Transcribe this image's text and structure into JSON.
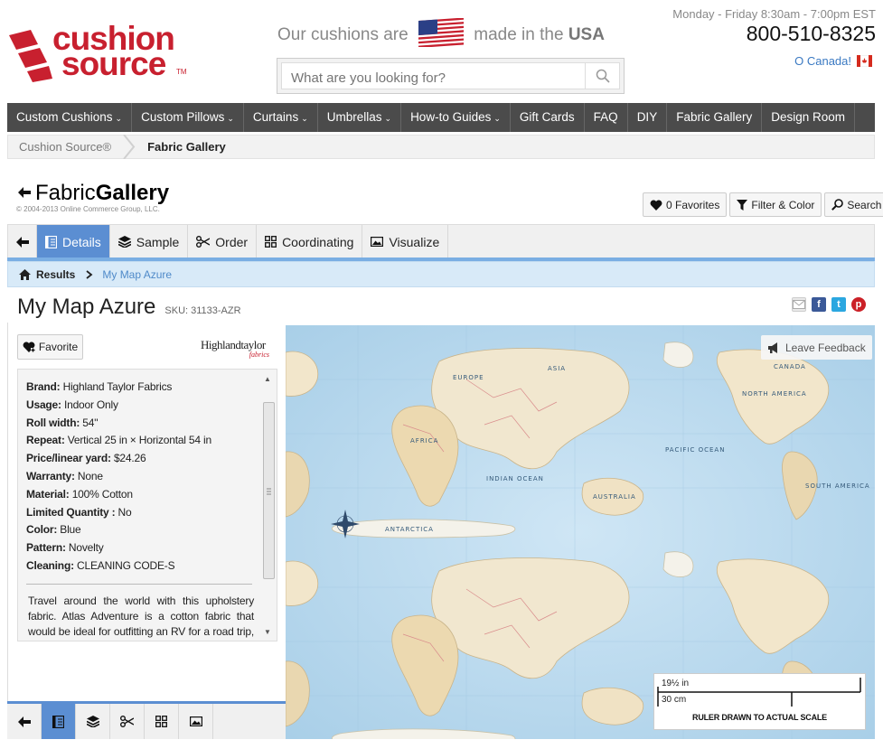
{
  "header": {
    "logo_line1": "cushion",
    "logo_line2": "source",
    "logo_tm": "TM",
    "tagline_pre": "Our cushions are",
    "tagline_mid": "made in the",
    "tagline_bold": "USA",
    "search_placeholder": "What are you looking for?",
    "hours": "Monday - Friday 8:30am - 7:00pm EST",
    "phone": "800-510-8325",
    "canada": "O Canada!"
  },
  "nav": [
    {
      "label": "Custom Cushions",
      "dropdown": true
    },
    {
      "label": "Custom Pillows",
      "dropdown": true
    },
    {
      "label": "Curtains",
      "dropdown": true
    },
    {
      "label": "Umbrellas",
      "dropdown": true
    },
    {
      "label": "How-to Guides",
      "dropdown": true
    },
    {
      "label": "Gift Cards",
      "dropdown": false
    },
    {
      "label": "FAQ",
      "dropdown": false
    },
    {
      "label": "DIY",
      "dropdown": false
    },
    {
      "label": "Fabric Gallery",
      "dropdown": false
    },
    {
      "label": "Design Room",
      "dropdown": false
    }
  ],
  "breadcrumb": {
    "home": "Cushion Source®",
    "current": "Fabric Gallery"
  },
  "gallery": {
    "title_light": "Fabric",
    "title_bold": "Gallery",
    "copyright": "© 2004-2013 Online Commerce Group, LLC.",
    "favorites_label": "0 Favorites",
    "filter_label": "Filter & Color",
    "search_label": "Search"
  },
  "tabs": [
    {
      "label": "",
      "icon": "back-arrow-icon",
      "active": false
    },
    {
      "label": "Details",
      "icon": "book-icon",
      "active": true
    },
    {
      "label": "Sample",
      "icon": "layers-icon",
      "active": false
    },
    {
      "label": "Order",
      "icon": "scissors-icon",
      "active": false
    },
    {
      "label": "Coordinating",
      "icon": "grid-icon",
      "active": false
    },
    {
      "label": "Visualize",
      "icon": "image-icon",
      "active": false
    }
  ],
  "results_bar": {
    "results": "Results",
    "current": "My Map Azure"
  },
  "product": {
    "name": "My Map Azure",
    "sku": "SKU: 31133-AZR",
    "favorite_label": "Favorite",
    "brand_logo_main": "Highlandtaylor",
    "brand_logo_sub": "fabrics",
    "specs": [
      {
        "key": "Brand:",
        "value": "Highland Taylor Fabrics"
      },
      {
        "key": "Usage:",
        "value": "Indoor Only"
      },
      {
        "key": "Roll width:",
        "value": "54\""
      },
      {
        "key": "Repeat:",
        "value": "Vertical 25 in × Horizontal 54 in"
      },
      {
        "key": "Price/linear yard:",
        "value": "$24.26"
      },
      {
        "key": "Warranty:",
        "value": "None"
      },
      {
        "key": "Material:",
        "value": "100% Cotton"
      },
      {
        "key": "Limited Quantity :",
        "value": "No"
      },
      {
        "key": "Color:",
        "value": "Blue"
      },
      {
        "key": "Pattern:",
        "value": "Novelty"
      },
      {
        "key": "Cleaning:",
        "value": "CLEANING CODE-S"
      }
    ],
    "description": "Travel around the world with this upholstery fabric. Atlas Adventure is a cotton fabric that would be ideal for outfitting an RV for a road trip, or to inspire"
  },
  "image_panel": {
    "feedback_label": "Leave Feedback",
    "ruler_in": "19½ in",
    "ruler_cm": "30 cm",
    "ruler_note": "RULER DRAWN TO ACTUAL SCALE",
    "map_labels": [
      "ASIA",
      "CANADA",
      "NORTH AMERICA",
      "INDIAN OCEAN",
      "AUSTRALIA",
      "PACIFIC OCEAN",
      "ANTARCTICA",
      "SOUTH AMERICA",
      "AFRICA",
      "EUROPE"
    ]
  },
  "colors": {
    "brand_red": "#c8202f",
    "nav_bg": "#4b4b4b",
    "tab_active": "#5b8ed2",
    "results_bg": "#d8eaf8",
    "link_blue": "#4f8ac9"
  }
}
